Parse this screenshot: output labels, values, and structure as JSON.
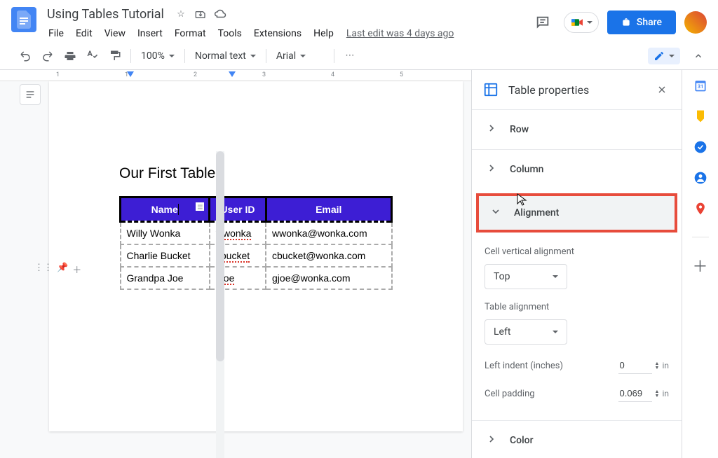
{
  "header": {
    "doc_title": "Using Tables Tutorial",
    "menus": [
      "File",
      "Edit",
      "View",
      "Insert",
      "Format",
      "Tools",
      "Extensions",
      "Help"
    ],
    "last_edit": "Last edit was 4 days ago",
    "share_label": "Share"
  },
  "toolbar": {
    "zoom": "100%",
    "style": "Normal text",
    "font": "Arial"
  },
  "document": {
    "heading": "Our First Table",
    "table": {
      "headers": [
        "Name",
        "User ID",
        "Email"
      ],
      "rows": [
        [
          "Willy Wonka",
          "wwonka",
          "wwonka@wonka.com"
        ],
        [
          "Charlie Bucket",
          "cbucket",
          "cbucket@wonka.com"
        ],
        [
          "Grandpa Joe",
          "gjoe",
          "gjoe@wonka.com"
        ]
      ]
    }
  },
  "sidepanel": {
    "title": "Table properties",
    "sections": {
      "row": "Row",
      "column": "Column",
      "alignment": "Alignment",
      "color": "Color"
    },
    "alignment": {
      "cell_vertical_label": "Cell vertical alignment",
      "cell_vertical_value": "Top",
      "table_align_label": "Table alignment",
      "table_align_value": "Left",
      "left_indent_label": "Left indent (inches)",
      "left_indent_value": "0",
      "cell_padding_label": "Cell padding",
      "cell_padding_value": "0.069",
      "unit": "in"
    }
  },
  "ruler": {
    "marks": [
      "1",
      "2",
      "3",
      "4",
      "5"
    ]
  }
}
